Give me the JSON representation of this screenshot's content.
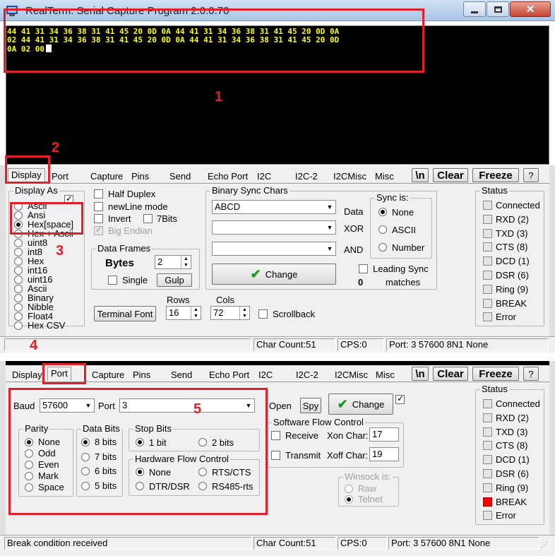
{
  "window": {
    "title": "RealTerm: Serial Capture Program 2.0.0.70"
  },
  "terminal": {
    "lines": [
      "44 41 31 34 36 38 31 41 45 20 0D 0A 44 41 31 34 36 38 31 41 45 20 0D 0A",
      "02 44 41 31 34 36 38 31 41 45 20 0D 0A 44 41 31 34 36 38 31 41 45 20 0D",
      "0A 02 00"
    ]
  },
  "tabs": [
    "Display",
    "Port",
    "Capture",
    "Pins",
    "Send",
    "Echo Port",
    "I2C",
    "I2C-2",
    "I2CMisc",
    "Misc"
  ],
  "tab_buttons": {
    "newline": "\\n",
    "clear": "Clear",
    "freeze": "Freeze",
    "help": "?"
  },
  "display": {
    "display_as_label": "Display As",
    "display_as_options": [
      "Ascii",
      "Ansi",
      "Hex[space]",
      "Hex + Ascii",
      "uint8",
      "int8",
      "Hex",
      "int16",
      "uint16",
      "Ascii",
      "Binary",
      "Nibble",
      "Float4",
      "Hex CSV"
    ],
    "display_as_selected": "Hex[space]",
    "half_duplex": "Half Duplex",
    "newline_mode": "newLine mode",
    "invert": "Invert",
    "seven_bits": "7Bits",
    "big_endian": "Big Endian",
    "data_frames_label": "Data Frames",
    "bytes_label": "Bytes",
    "bytes_value": "2",
    "single": "Single",
    "gulp": "Gulp",
    "terminal_font": "Terminal Font",
    "rows_label": "Rows",
    "rows_value": "16",
    "cols_label": "Cols",
    "cols_value": "72",
    "scrollback": "Scrollback",
    "binary_sync_label": "Binary Sync Chars",
    "sync_value": "ABCD",
    "data_label": "Data",
    "xor_label": "XOR",
    "and_label": "AND",
    "sync_is_label": "Sync is:",
    "sync_options": [
      "None",
      "ASCII",
      "Number"
    ],
    "sync_selected": "None",
    "change": "Change",
    "leading_sync": "Leading Sync",
    "matches_count": "0",
    "matches": "matches"
  },
  "status_panel": {
    "label": "Status",
    "items": [
      "Connected",
      "RXD (2)",
      "TXD (3)",
      "CTS (8)",
      "DCD (1)",
      "DSR (6)",
      "Ring (9)",
      "BREAK",
      "Error"
    ],
    "active_bottom": "BREAK",
    "active_color": "#ff0000"
  },
  "statusbar_top": {
    "message": "",
    "char_count": "Char Count:51",
    "cps": "CPS:0",
    "port": "Port: 3 57600 8N1 None"
  },
  "port": {
    "baud_label": "Baud",
    "baud_value": "57600",
    "port_label": "Port",
    "port_value": "3",
    "open": "Open",
    "spy": "Spy",
    "change": "Change",
    "parity_label": "Parity",
    "parity_options": [
      "None",
      "Odd",
      "Even",
      "Mark",
      "Space"
    ],
    "parity_selected": "None",
    "data_bits_label": "Data Bits",
    "data_bits_options": [
      "8 bits",
      "7 bits",
      "6 bits",
      "5 bits"
    ],
    "data_bits_selected": "8 bits",
    "stop_bits_label": "Stop Bits",
    "stop_bits_options": [
      "1 bit",
      "2 bits"
    ],
    "stop_bits_selected": "1 bit",
    "hw_flow_label": "Hardware Flow Control",
    "hw_flow_options": [
      "None",
      "RTS/CTS",
      "DTR/DSR",
      "RS485-rts"
    ],
    "hw_flow_selected": "None",
    "sw_flow_label": "Software Flow Control",
    "receive": "Receive",
    "xon_label": "Xon Char:",
    "xon_value": "17",
    "transmit": "Transmit",
    "xoff_label": "Xoff Char:",
    "xoff_value": "19",
    "winsock_label": "Winsock is:",
    "winsock_options": [
      "Raw",
      "Telnet"
    ],
    "winsock_selected": "Telnet"
  },
  "statusbar_bottom": {
    "message": "Break condition received",
    "char_count": "Char Count:51",
    "cps": "CPS:0",
    "port": "Port: 3 57600 8N1 None"
  },
  "annotations": [
    "1",
    "2",
    "3",
    "4",
    "5"
  ],
  "colors": {
    "annotation": "#e0202a",
    "terminal_text": "#ffff00",
    "terminal_bg": "#000000",
    "check_green": "#1a9a1a"
  }
}
